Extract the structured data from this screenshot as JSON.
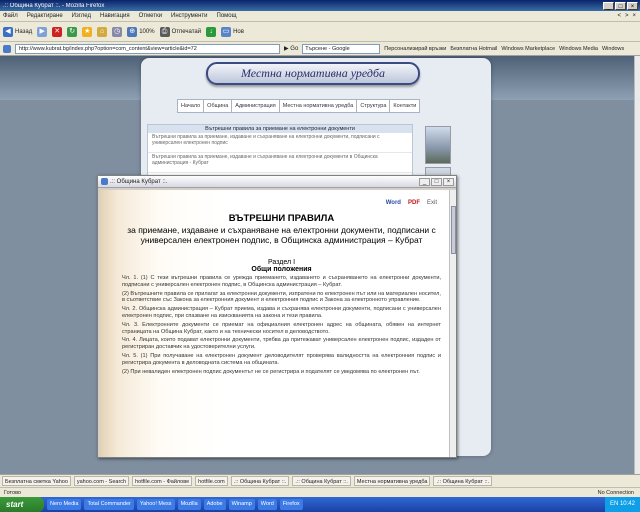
{
  "browser": {
    "title": ".:: Община Кубрат ::. - Mozilla Firefox",
    "menu": [
      "Файл",
      "Редактиране",
      "Изглед",
      "Навигация",
      "Отметки",
      "Инструменти",
      "Помощ"
    ],
    "toolbar": {
      "back": "Назад",
      "zoom": "100%",
      "print": "Отпечатай",
      "new": "Нов"
    },
    "address": "http://www.kubrat.bg/index.php?option=com_content&view=article&id=72",
    "search_placeholder": "Търсене - Google",
    "links": [
      "Персонализирай връзки",
      "Безплатна Hotmail",
      "Windows Marketplace",
      "Windows Media",
      "Windows"
    ]
  },
  "page": {
    "logo_text": "Местна нормативна уредба",
    "nav": [
      "Начало",
      "Община",
      "Администрация",
      "Местна нормативна уредба",
      "Структура",
      "Контакти"
    ],
    "content_box": {
      "title": "Вътрешни правила за приемане на електронни документи",
      "items": [
        "Вътрешни правила за приемане, издаване и съхраняване на електронни документи, подписани с универсален електронен подпис",
        "Вътрешни правила за приемане, издаване и съхраняване на електронни документи в Общинска администрация - Кубрат"
      ]
    }
  },
  "popup": {
    "title": ".:: Община Кубрат ::.",
    "doc_title": "ВЪТРЕШНИ ПРАВИЛА",
    "doc_subtitle": "за приемане, издаване и съхраняване на електронни документи, подписани с универсален електронен подпис, в Общинска администрация – Кубрат",
    "section": "Раздел I",
    "section_title": "Общи положения",
    "icons": [
      "Word",
      "PDF",
      "Exit"
    ],
    "paragraphs": [
      "Чл. 1. (1) С тези вътрешни правила се урежда приемането, издаването и съхраняването на електронни документи, подписани с универсален електронен подпис, в Общинска администрация – Кубрат.",
      "(2) Вътрешните правила се прилагат за електронни документи, изпратени по електронен път или на материален носител, в съответствие със Закона за електронния документ и електронния подпис и Закона за електронното управление.",
      "Чл. 2. Общинска администрация – Кубрат приема, издава и съхранява електронни документи, подписани с универсален електронен подпис, при спазване на изискванията на закона и тези правила.",
      "Чл. 3. Електронните документи се приемат на официалния електронен адрес на общината, обявен на интернет страницата на Община Кубрат, както и на технически носител в деловодството.",
      "Чл. 4. Лицата, които подават електронни документи, трябва да притежават универсален електронен подпис, издаден от регистриран доставчик на удостоверителни услуги.",
      "Чл. 5. (1) При получаване на електронен документ деловодителят проверява валидността на електронния подпис и регистрира документа в деловодната система на общината.",
      "(2) При невалиден електронен подпис документът не се регистрира и подателят се уведомява по електронен път."
    ]
  },
  "tabs": [
    "Безплатна сметка Yahoo",
    "yahoo.com - Search",
    "hotfile.com - Файлове",
    "hotfile.com",
    ".:: Община Кубрат ::.",
    ".:: Община Кубрат ::.",
    "Местна нормативна уредба",
    ".:: Община Кубрат ::."
  ],
  "status": {
    "left": "Готово",
    "right": "No Connection"
  },
  "taskbar": {
    "start": "start",
    "tasks": [
      "Nero Media",
      "Total Commander",
      "Yahoo! Mess",
      "Mozilla",
      "Adobe",
      "Winamp",
      "Word",
      "Firefox"
    ],
    "clock": "EN  10:42"
  },
  "thumb_colors": [
    "#8d9bb0",
    "#b4b0a6",
    "#7d6f66",
    "#9ea8b6",
    "#a48878",
    "#6d8c5e",
    "#90a0b8",
    "#7a8ea4"
  ]
}
